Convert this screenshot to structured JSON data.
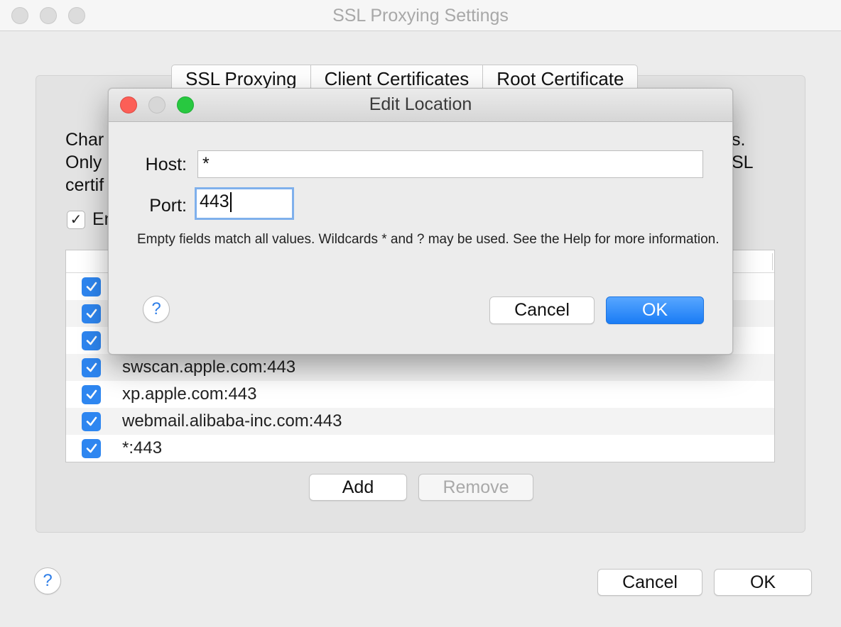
{
  "window": {
    "title": "SSL Proxying Settings"
  },
  "tabs": [
    {
      "label": "SSL Proxying"
    },
    {
      "label": "Client Certificates"
    },
    {
      "label": "Root Certificate"
    }
  ],
  "description": {
    "line1_left": "Char",
    "line2_left": "Only",
    "line3_left": "certif",
    "line1_right": "s.",
    "line2_right": "SL"
  },
  "enable": {
    "label_partial": "En",
    "checked": true
  },
  "locations": [
    {
      "text": "",
      "checked": true
    },
    {
      "text": "",
      "checked": true
    },
    {
      "text": "",
      "checked": true
    },
    {
      "text": "swscan.apple.com:443",
      "checked": true
    },
    {
      "text": "xp.apple.com:443",
      "checked": true
    },
    {
      "text": "webmail.alibaba-inc.com:443",
      "checked": true
    },
    {
      "text": "*:443",
      "checked": true
    }
  ],
  "buttons": {
    "add": "Add",
    "remove": "Remove",
    "cancel": "Cancel",
    "ok": "OK",
    "help": "?"
  },
  "dialog": {
    "title": "Edit Location",
    "host_label": "Host:",
    "host_value": "*",
    "port_label": "Port:",
    "port_value": "443",
    "hint": "Empty fields match all values. Wildcards * and ? may be used. See the Help for more information.",
    "cancel": "Cancel",
    "ok": "OK",
    "help": "?"
  },
  "colors": {
    "accent": "#2e86f0",
    "close": "#fc5f57",
    "minimize": "#d7d7d7",
    "zoom": "#28c840"
  }
}
